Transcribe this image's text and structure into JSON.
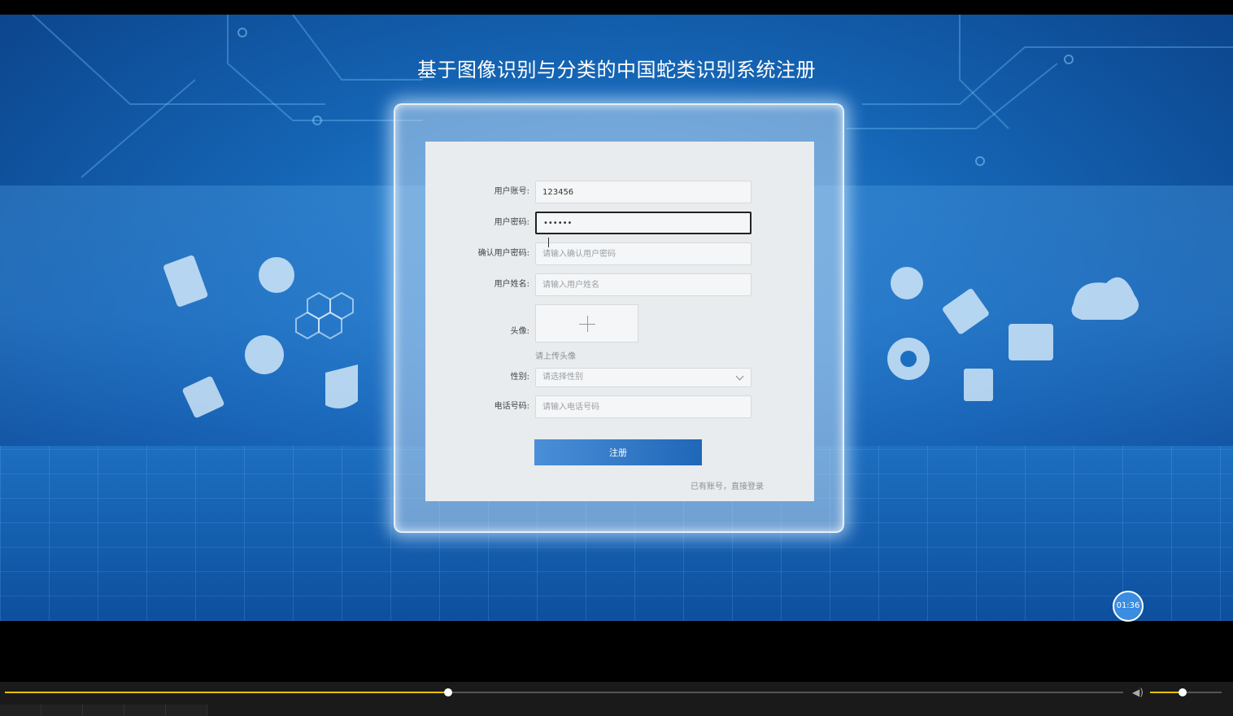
{
  "page": {
    "title": "基于图像识别与分类的中国蛇类识别系统注册"
  },
  "form": {
    "account": {
      "label": "用户账号:",
      "value": "123456"
    },
    "password": {
      "label": "用户密码:",
      "value": "••••••"
    },
    "confirm_password": {
      "label": "确认用户密码:",
      "placeholder": "请输入确认用户密码"
    },
    "name": {
      "label": "用户姓名:",
      "placeholder": "请输入用户姓名"
    },
    "avatar": {
      "label": "头像:",
      "hint": "请上传头像"
    },
    "gender": {
      "label": "性别:",
      "placeholder": "请选择性别"
    },
    "phone": {
      "label": "电话号码:",
      "placeholder": "请输入电话号码"
    },
    "submit_label": "注册",
    "login_link": "已有账号，直接登录"
  },
  "player": {
    "timer": "01:36",
    "progress": 0.39,
    "volume": 0.45
  },
  "colors": {
    "accent": "#2a7fd4",
    "progress": "#e6c200"
  },
  "icons": [
    "plus-icon",
    "chevron-down-icon",
    "speaker-icon",
    "text-cursor-icon"
  ]
}
